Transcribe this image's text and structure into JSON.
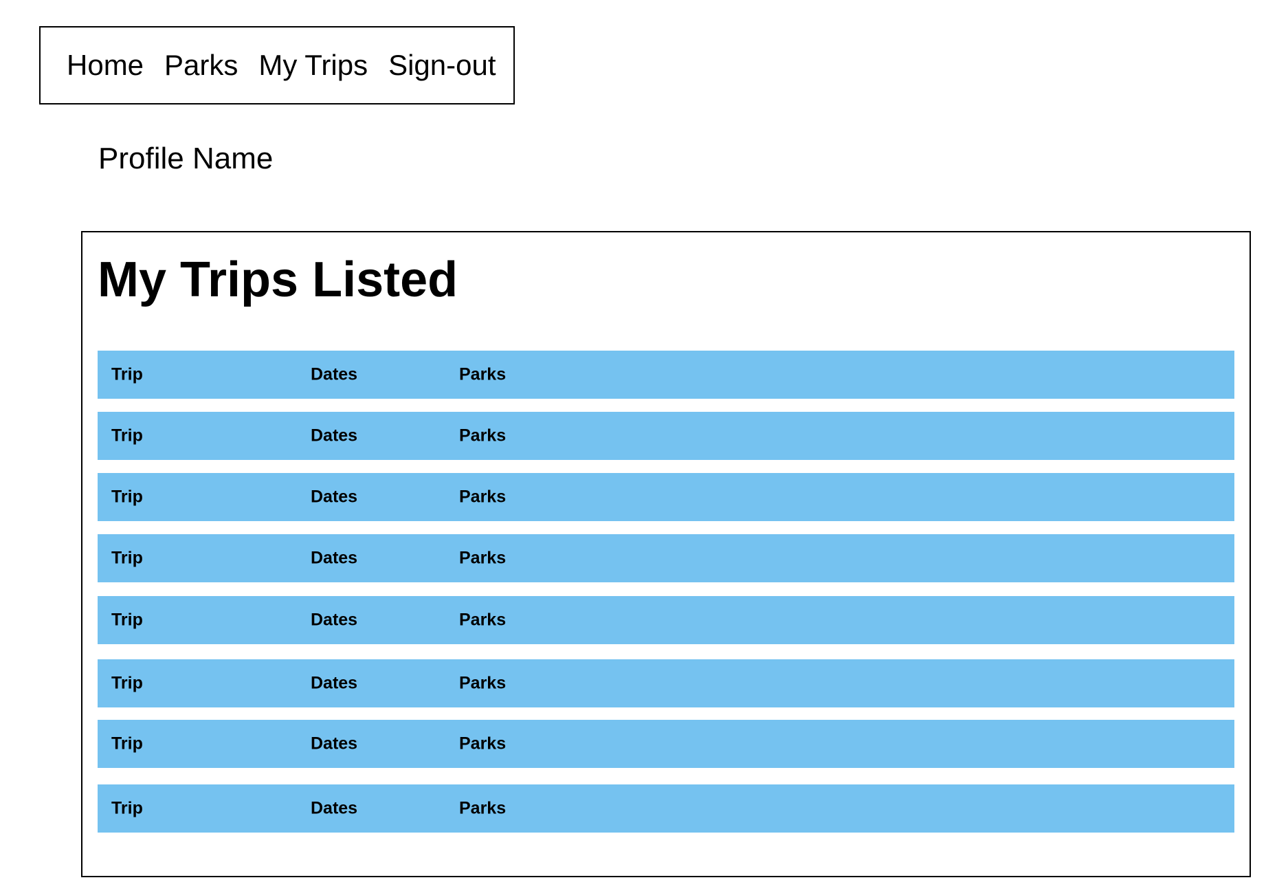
{
  "nav": {
    "items": [
      {
        "label": "Home"
      },
      {
        "label": "Parks"
      },
      {
        "label": "My Trips"
      },
      {
        "label": "Sign-out"
      }
    ]
  },
  "profile": {
    "name": "Profile Name"
  },
  "trips": {
    "title": "My Trips Listed",
    "row_color": "#75c2f0",
    "rows": [
      {
        "trip": "Trip",
        "dates": "Dates",
        "parks": "Parks"
      },
      {
        "trip": "Trip",
        "dates": "Dates",
        "parks": "Parks"
      },
      {
        "trip": "Trip",
        "dates": "Dates",
        "parks": "Parks"
      },
      {
        "trip": "Trip",
        "dates": "Dates",
        "parks": "Parks"
      },
      {
        "trip": "Trip",
        "dates": "Dates",
        "parks": "Parks"
      },
      {
        "trip": "Trip",
        "dates": "Dates",
        "parks": "Parks"
      },
      {
        "trip": "Trip",
        "dates": "Dates",
        "parks": "Parks"
      },
      {
        "trip": "Trip",
        "dates": "Dates",
        "parks": "Parks"
      }
    ]
  }
}
